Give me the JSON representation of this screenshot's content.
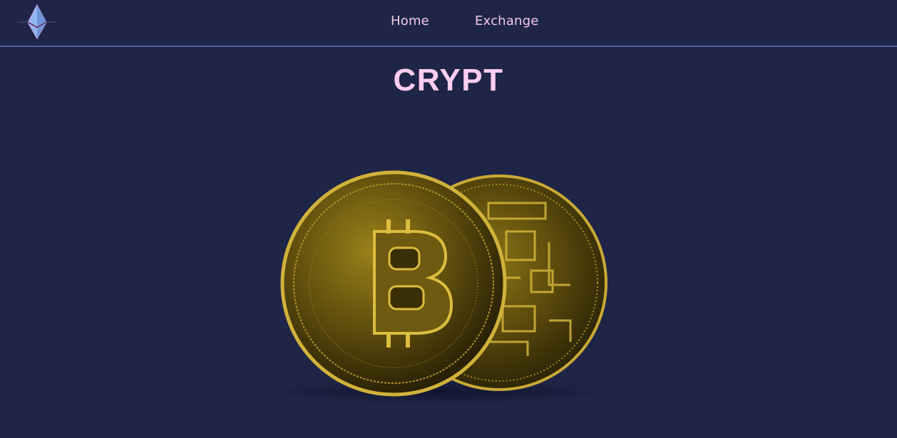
{
  "nav": {
    "logo_icon": "ethereum-diamond-icon",
    "links": [
      {
        "label": "Home"
      },
      {
        "label": "Exchange"
      }
    ]
  },
  "hero": {
    "title": "CRYPT",
    "image": "two-bitcoin-coins-image"
  },
  "colors": {
    "background": "#1f2547",
    "nav_divider": "#4f5a9c",
    "link_text": "#f2c7e6",
    "title_text": "#ffcdee",
    "coin_gold": "#b8961e"
  }
}
